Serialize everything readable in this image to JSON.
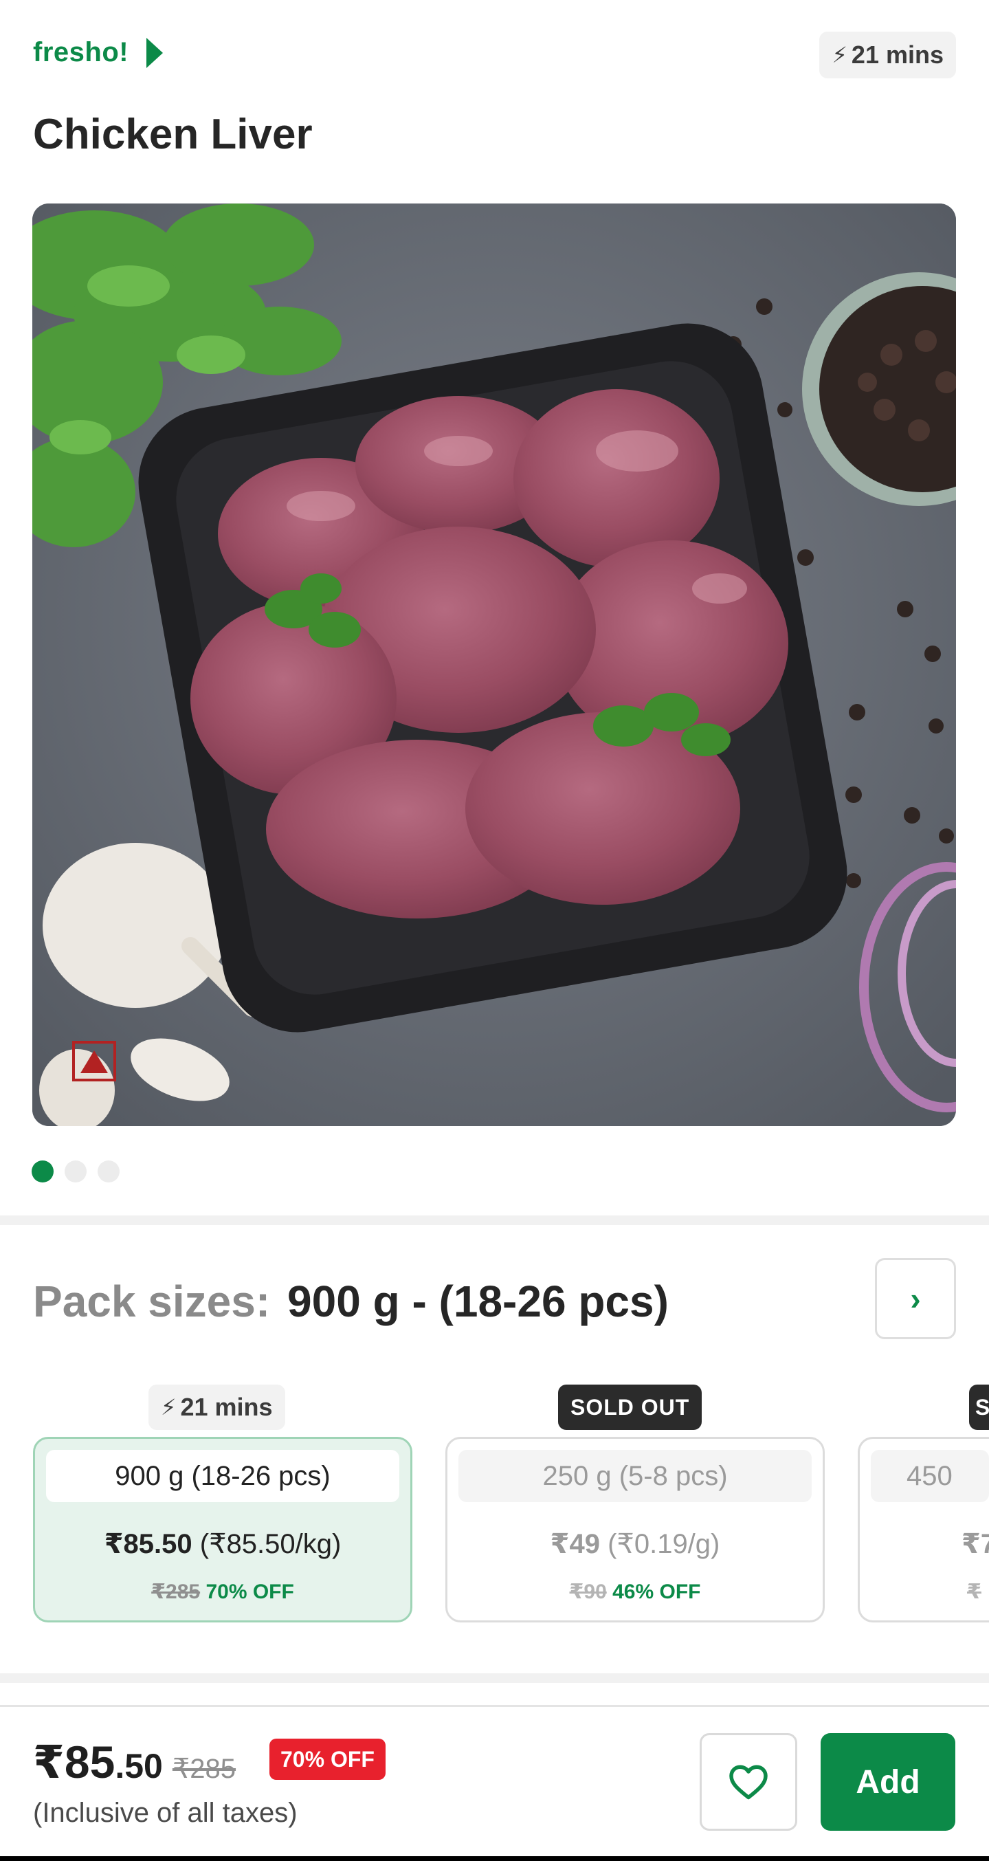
{
  "header": {
    "brand": "fresho!",
    "eta": "21 mins"
  },
  "product": {
    "title": "Chicken Liver",
    "image_description_icon": "product-photo",
    "carousel": {
      "count": 3,
      "active_index": 0
    }
  },
  "pack_sizes": {
    "label": "Pack sizes:",
    "selected": "900 g - (18-26 pcs)"
  },
  "variants": [
    {
      "tag": "21 mins",
      "tag_type": "eta",
      "size": "900 g (18-26 pcs)",
      "price": "₹85.50",
      "unit_price": "(₹85.50/kg)",
      "mrp": "₹285",
      "off": "70% OFF",
      "selected": true
    },
    {
      "tag": "SOLD OUT",
      "tag_type": "sold",
      "size": "250 g (5-8 pcs)",
      "price": "₹49",
      "unit_price": "(₹0.19/g)",
      "mrp": "₹90",
      "off": "46% OFF",
      "selected": false
    },
    {
      "tag": "S",
      "tag_type": "sold",
      "size": "450",
      "price": "₹7",
      "unit_price": "",
      "mrp": "₹",
      "off": "",
      "selected": false
    }
  ],
  "bottom_bar": {
    "price_main": "₹85",
    "price_decimal": ".50",
    "mrp": "₹285",
    "off": "70% OFF",
    "tax_note": "(Inclusive of all taxes)",
    "add_label": "Add"
  },
  "colors": {
    "brand_green": "#0c8a48",
    "discount_red": "#e8212d"
  }
}
